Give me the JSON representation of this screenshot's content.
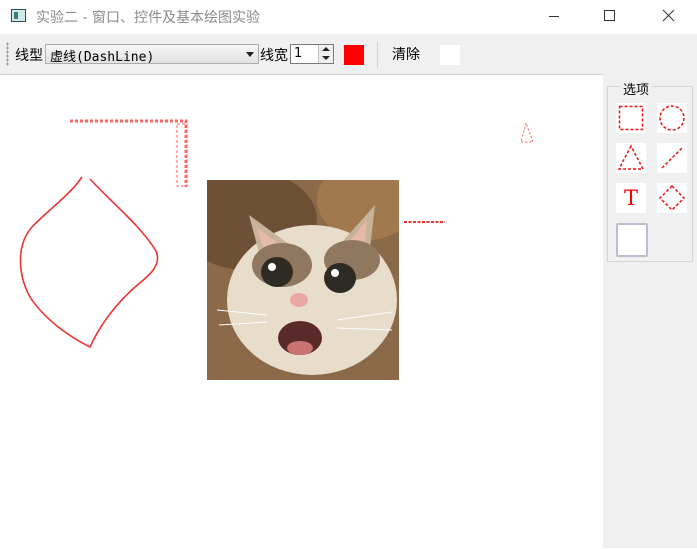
{
  "window": {
    "title": "实验二 - 窗口、控件及基本绘图实验",
    "controls": [
      "minimize-icon",
      "maximize-icon",
      "close-icon"
    ]
  },
  "toolbar": {
    "line_type_label": "线型",
    "line_type_value": "虚线(DashLine)",
    "line_width_label": "线宽",
    "line_width_value": "1",
    "pen_color": "#ff0000",
    "clear_label": "清除",
    "fill_color": "#ffffff"
  },
  "sidepanel": {
    "group_title": "选项",
    "tools": [
      {
        "name": "rectangle-tool",
        "icon": "dashed-rectangle-icon"
      },
      {
        "name": "ellipse-tool",
        "icon": "dashed-circle-icon"
      },
      {
        "name": "triangle-tool",
        "icon": "dashed-triangle-icon"
      },
      {
        "name": "line-tool",
        "icon": "dashed-line-icon"
      },
      {
        "name": "text-tool",
        "label": "T",
        "icon": "text-icon"
      },
      {
        "name": "diamond-tool",
        "icon": "dashed-diamond-icon"
      },
      {
        "name": "image-tool",
        "icon": "blank-image-icon",
        "selected": true
      }
    ]
  },
  "canvas": {
    "stroke_color": "#ff4444",
    "image": "cat-photo"
  }
}
